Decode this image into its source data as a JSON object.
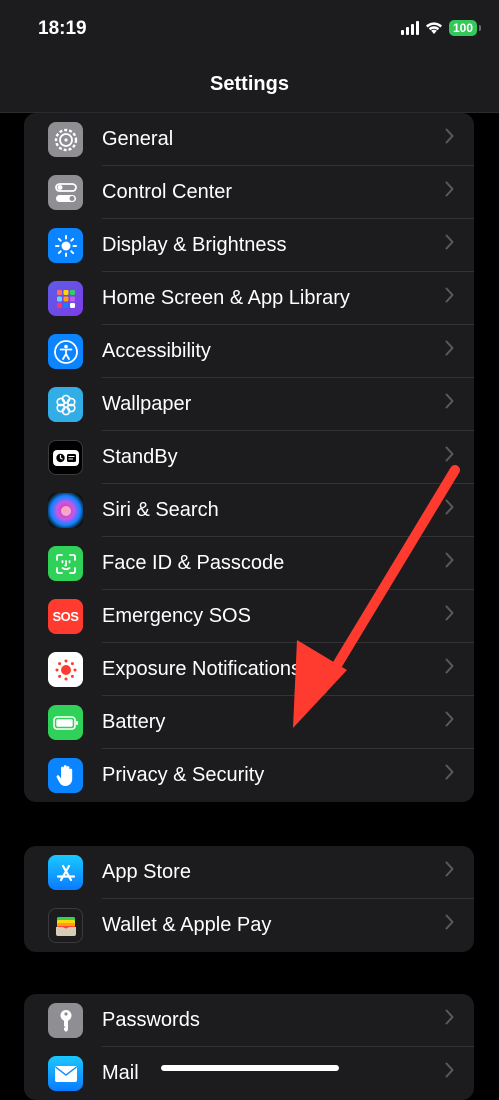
{
  "status_bar": {
    "time": "18:19",
    "battery": "100"
  },
  "nav": {
    "title": "Settings"
  },
  "groups": [
    {
      "items": [
        {
          "label": "General"
        },
        {
          "label": "Control Center"
        },
        {
          "label": "Display & Brightness"
        },
        {
          "label": "Home Screen & App Library"
        },
        {
          "label": "Accessibility"
        },
        {
          "label": "Wallpaper"
        },
        {
          "label": "StandBy"
        },
        {
          "label": "Siri & Search"
        },
        {
          "label": "Face ID & Passcode"
        },
        {
          "label": "Emergency SOS",
          "icon_text": "SOS"
        },
        {
          "label": "Exposure Notifications"
        },
        {
          "label": "Battery"
        },
        {
          "label": "Privacy & Security"
        }
      ]
    },
    {
      "items": [
        {
          "label": "App Store"
        },
        {
          "label": "Wallet & Apple Pay"
        }
      ]
    },
    {
      "items": [
        {
          "label": "Passwords"
        },
        {
          "label": "Mail"
        }
      ]
    }
  ],
  "colors": {
    "annotation_arrow": "#ff3b30",
    "battery_green": "#34c759"
  }
}
